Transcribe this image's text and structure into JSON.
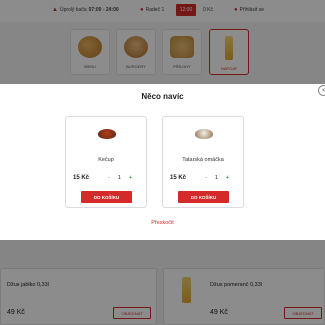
{
  "topbar": {
    "hours_label": "Úprolý bača",
    "hours_value": "07:00 - 24:00",
    "location": "Radeč 1",
    "time_select": "12:00",
    "cart": "0 Kč",
    "login": "Přihlásit se"
  },
  "categories": [
    {
      "label": "MENU"
    },
    {
      "label": "BURGERY"
    },
    {
      "label": "PŘÍLOHY"
    },
    {
      "label": "NÁPOJE"
    }
  ],
  "modal": {
    "title": "Něco navíc",
    "close": "×",
    "products": [
      {
        "name": "Kečup",
        "price": "15 Kč",
        "minus": "-",
        "qty": "1",
        "plus": "+",
        "button": "DO KOŠÍKU"
      },
      {
        "name": "Tatarská omáčka",
        "price": "15 Kč",
        "minus": "-",
        "qty": "1",
        "plus": "+",
        "button": "DO KOŠÍKU"
      }
    ],
    "skip": "Přeskočit"
  },
  "products_below": [
    {
      "name": "Džus jablko 0,33l",
      "price": "49 Kč",
      "button": "OBJEDNAT"
    },
    {
      "name": "Džus pomeranč 0,33l",
      "price": "49 Kč",
      "button": "OBJEDNAT"
    }
  ],
  "colors": {
    "accent": "#d42a2a",
    "plus": "#2a9d3c"
  }
}
